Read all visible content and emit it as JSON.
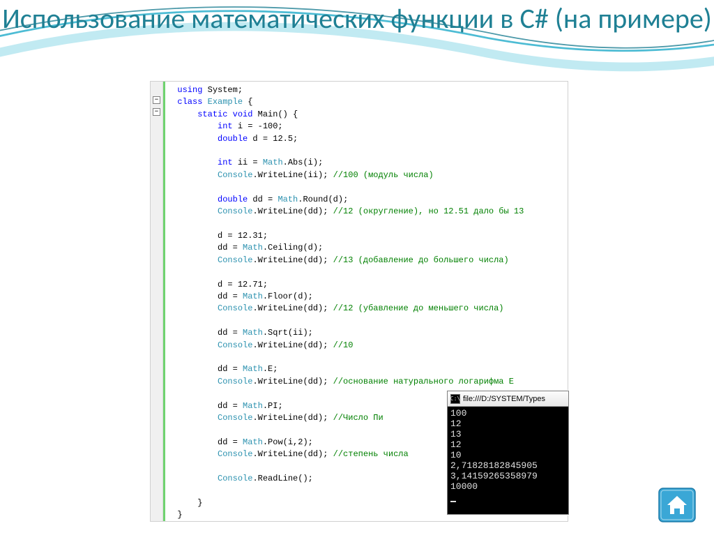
{
  "slide": {
    "title": "Использование математических функции в C# (на примере)"
  },
  "code": {
    "lines": [
      {
        "indent": 0,
        "segs": [
          {
            "t": "using ",
            "c": "kw"
          },
          {
            "t": "System;",
            "c": ""
          }
        ]
      },
      {
        "indent": 0,
        "segs": [
          {
            "t": "class ",
            "c": "kw"
          },
          {
            "t": "Example",
            "c": "cls"
          },
          {
            "t": " {",
            "c": ""
          }
        ],
        "fold": true
      },
      {
        "indent": 1,
        "segs": [
          {
            "t": "static void ",
            "c": "kw"
          },
          {
            "t": "Main() {",
            "c": ""
          }
        ],
        "fold": true
      },
      {
        "indent": 2,
        "segs": [
          {
            "t": "int",
            "c": "kw"
          },
          {
            "t": " i = -100;",
            "c": ""
          }
        ]
      },
      {
        "indent": 2,
        "segs": [
          {
            "t": "double",
            "c": "kw"
          },
          {
            "t": " d = 12.5;",
            "c": ""
          }
        ]
      },
      {
        "indent": 2,
        "segs": [
          {
            "t": "",
            "c": ""
          }
        ]
      },
      {
        "indent": 2,
        "segs": [
          {
            "t": "int",
            "c": "kw"
          },
          {
            "t": " ii = ",
            "c": ""
          },
          {
            "t": "Math",
            "c": "cls"
          },
          {
            "t": ".Abs(i);",
            "c": ""
          }
        ]
      },
      {
        "indent": 2,
        "segs": [
          {
            "t": "Console",
            "c": "cls"
          },
          {
            "t": ".WriteLine(ii); ",
            "c": ""
          },
          {
            "t": "//100 (модуль числа)",
            "c": "cm"
          }
        ]
      },
      {
        "indent": 2,
        "segs": [
          {
            "t": "",
            "c": ""
          }
        ]
      },
      {
        "indent": 2,
        "segs": [
          {
            "t": "double",
            "c": "kw"
          },
          {
            "t": " dd = ",
            "c": ""
          },
          {
            "t": "Math",
            "c": "cls"
          },
          {
            "t": ".Round(d);",
            "c": ""
          }
        ]
      },
      {
        "indent": 2,
        "segs": [
          {
            "t": "Console",
            "c": "cls"
          },
          {
            "t": ".WriteLine(dd); ",
            "c": ""
          },
          {
            "t": "//12 (округление), но 12.51 дало бы 13",
            "c": "cm"
          }
        ]
      },
      {
        "indent": 2,
        "segs": [
          {
            "t": "",
            "c": ""
          }
        ]
      },
      {
        "indent": 2,
        "segs": [
          {
            "t": "d = 12.31;",
            "c": ""
          }
        ]
      },
      {
        "indent": 2,
        "segs": [
          {
            "t": "dd = ",
            "c": ""
          },
          {
            "t": "Math",
            "c": "cls"
          },
          {
            "t": ".Ceiling(d);",
            "c": ""
          }
        ]
      },
      {
        "indent": 2,
        "segs": [
          {
            "t": "Console",
            "c": "cls"
          },
          {
            "t": ".WriteLine(dd); ",
            "c": ""
          },
          {
            "t": "//13 (добавление до большего числа)",
            "c": "cm"
          }
        ]
      },
      {
        "indent": 2,
        "segs": [
          {
            "t": "",
            "c": ""
          }
        ]
      },
      {
        "indent": 2,
        "segs": [
          {
            "t": "d = 12.71;",
            "c": ""
          }
        ]
      },
      {
        "indent": 2,
        "segs": [
          {
            "t": "dd = ",
            "c": ""
          },
          {
            "t": "Math",
            "c": "cls"
          },
          {
            "t": ".Floor(d);",
            "c": ""
          }
        ]
      },
      {
        "indent": 2,
        "segs": [
          {
            "t": "Console",
            "c": "cls"
          },
          {
            "t": ".WriteLine(dd); ",
            "c": ""
          },
          {
            "t": "//12 (убавление до меньшего числа)",
            "c": "cm"
          }
        ]
      },
      {
        "indent": 2,
        "segs": [
          {
            "t": "",
            "c": ""
          }
        ]
      },
      {
        "indent": 2,
        "segs": [
          {
            "t": "dd = ",
            "c": ""
          },
          {
            "t": "Math",
            "c": "cls"
          },
          {
            "t": ".Sqrt(ii);",
            "c": ""
          }
        ]
      },
      {
        "indent": 2,
        "segs": [
          {
            "t": "Console",
            "c": "cls"
          },
          {
            "t": ".WriteLine(dd); ",
            "c": ""
          },
          {
            "t": "//10",
            "c": "cm"
          }
        ]
      },
      {
        "indent": 2,
        "segs": [
          {
            "t": "",
            "c": ""
          }
        ]
      },
      {
        "indent": 2,
        "segs": [
          {
            "t": "dd = ",
            "c": ""
          },
          {
            "t": "Math",
            "c": "cls"
          },
          {
            "t": ".E;",
            "c": ""
          }
        ]
      },
      {
        "indent": 2,
        "segs": [
          {
            "t": "Console",
            "c": "cls"
          },
          {
            "t": ".WriteLine(dd); ",
            "c": ""
          },
          {
            "t": "//основание натурального логарифма E",
            "c": "cm"
          }
        ]
      },
      {
        "indent": 2,
        "segs": [
          {
            "t": "",
            "c": ""
          }
        ]
      },
      {
        "indent": 2,
        "segs": [
          {
            "t": "dd = ",
            "c": ""
          },
          {
            "t": "Math",
            "c": "cls"
          },
          {
            "t": ".PI;",
            "c": ""
          }
        ]
      },
      {
        "indent": 2,
        "segs": [
          {
            "t": "Console",
            "c": "cls"
          },
          {
            "t": ".WriteLine(dd); ",
            "c": ""
          },
          {
            "t": "//Число Пи",
            "c": "cm"
          }
        ]
      },
      {
        "indent": 2,
        "segs": [
          {
            "t": "",
            "c": ""
          }
        ]
      },
      {
        "indent": 2,
        "segs": [
          {
            "t": "dd = ",
            "c": ""
          },
          {
            "t": "Math",
            "c": "cls"
          },
          {
            "t": ".Pow(i,2);",
            "c": ""
          }
        ]
      },
      {
        "indent": 2,
        "segs": [
          {
            "t": "Console",
            "c": "cls"
          },
          {
            "t": ".WriteLine(dd); ",
            "c": ""
          },
          {
            "t": "//степень числа",
            "c": "cm"
          }
        ]
      },
      {
        "indent": 2,
        "segs": [
          {
            "t": "",
            "c": ""
          }
        ]
      },
      {
        "indent": 2,
        "segs": [
          {
            "t": "Console",
            "c": "cls"
          },
          {
            "t": ".ReadLine();",
            "c": ""
          }
        ]
      },
      {
        "indent": 2,
        "segs": [
          {
            "t": "",
            "c": ""
          }
        ]
      },
      {
        "indent": 1,
        "segs": [
          {
            "t": "}",
            "c": ""
          }
        ]
      },
      {
        "indent": 0,
        "segs": [
          {
            "t": "}",
            "c": ""
          }
        ]
      }
    ]
  },
  "console": {
    "title": "file:///D:/SYSTEM/Types",
    "output": [
      "100",
      "12",
      "13",
      "12",
      "10",
      "2,71828182845905",
      "3,14159265358979",
      "10000"
    ]
  }
}
